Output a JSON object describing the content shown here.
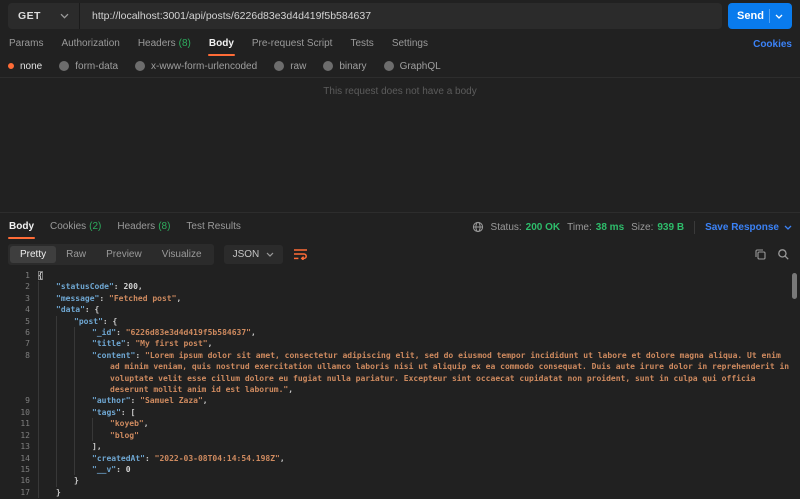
{
  "request": {
    "method": "GET",
    "url": "http://localhost:3001/api/posts/6226d83e3d4d419f5b584637",
    "send_label": "Send",
    "cookies_link": "Cookies",
    "tabs": [
      {
        "label": "Params"
      },
      {
        "label": "Authorization"
      },
      {
        "label": "Headers",
        "count": "(8)"
      },
      {
        "label": "Body",
        "active": true
      },
      {
        "label": "Pre-request Script"
      },
      {
        "label": "Tests"
      },
      {
        "label": "Settings"
      }
    ],
    "body_types": [
      {
        "label": "none",
        "selected": true
      },
      {
        "label": "form-data"
      },
      {
        "label": "x-www-form-urlencoded"
      },
      {
        "label": "raw"
      },
      {
        "label": "binary"
      },
      {
        "label": "GraphQL"
      }
    ],
    "empty_body_message": "This request does not have a body"
  },
  "response": {
    "tabs": [
      {
        "label": "Body",
        "active": true
      },
      {
        "label": "Cookies",
        "count": "(2)"
      },
      {
        "label": "Headers",
        "count": "(8)"
      },
      {
        "label": "Test Results"
      }
    ],
    "meta": {
      "status_label": "Status:",
      "status_value": "200 OK",
      "time_label": "Time:",
      "time_value": "38 ms",
      "size_label": "Size:",
      "size_value": "939 B",
      "save_label": "Save Response"
    },
    "view_tabs": [
      {
        "label": "Pretty",
        "active": true
      },
      {
        "label": "Raw"
      },
      {
        "label": "Preview"
      },
      {
        "label": "Visualize"
      }
    ],
    "format": "JSON"
  },
  "colors": {
    "accent_orange": "#ff6c37",
    "send_blue": "#097bed",
    "link_blue": "#3b82f6",
    "success_green": "#2ebd6b",
    "json_key": "#6fa7d2",
    "json_string": "#ce8a5f"
  },
  "code": {
    "lines": [
      {
        "n": 1,
        "indent": 0,
        "tokens": [
          {
            "t": "p",
            "v": "{",
            "hl": true
          }
        ]
      },
      {
        "n": 2,
        "indent": 1,
        "tokens": [
          {
            "t": "k",
            "v": "\"statusCode\""
          },
          {
            "t": "p",
            "v": ": "
          },
          {
            "t": "n",
            "v": "200"
          },
          {
            "t": "p",
            "v": ","
          }
        ]
      },
      {
        "n": 3,
        "indent": 1,
        "tokens": [
          {
            "t": "k",
            "v": "\"message\""
          },
          {
            "t": "p",
            "v": ": "
          },
          {
            "t": "s",
            "v": "\"Fetched post\""
          },
          {
            "t": "p",
            "v": ","
          }
        ]
      },
      {
        "n": 4,
        "indent": 1,
        "tokens": [
          {
            "t": "k",
            "v": "\"data\""
          },
          {
            "t": "p",
            "v": ": {"
          }
        ]
      },
      {
        "n": 5,
        "indent": 2,
        "tokens": [
          {
            "t": "k",
            "v": "\"post\""
          },
          {
            "t": "p",
            "v": ": {"
          }
        ]
      },
      {
        "n": 6,
        "indent": 3,
        "tokens": [
          {
            "t": "k",
            "v": "\"_id\""
          },
          {
            "t": "p",
            "v": ": "
          },
          {
            "t": "s",
            "v": "\"6226d83e3d4d419f5b584637\""
          },
          {
            "t": "p",
            "v": ","
          }
        ]
      },
      {
        "n": 7,
        "indent": 3,
        "tokens": [
          {
            "t": "k",
            "v": "\"title\""
          },
          {
            "t": "p",
            "v": ": "
          },
          {
            "t": "s",
            "v": "\"My first post\""
          },
          {
            "t": "p",
            "v": ","
          }
        ]
      },
      {
        "n": 8,
        "indent": 3,
        "tokens": [
          {
            "t": "k",
            "v": "\"content\""
          },
          {
            "t": "p",
            "v": ": "
          },
          {
            "t": "s",
            "v": "\"Lorem ipsum dolor sit amet, consectetur adipiscing elit, sed do eiusmod tempor incididunt ut labore et dolore magna aliqua. Ut enim ad minim veniam, quis nostrud exercitation ullamco laboris nisi ut aliquip ex ea commodo consequat. Duis aute irure dolor in reprehenderit in voluptate velit esse cillum dolore eu fugiat nulla pariatur. Excepteur sint occaecat cupidatat non proident, sunt in culpa qui officia deserunt mollit anim id est laborum.\""
          },
          {
            "t": "p",
            "v": ","
          }
        ]
      },
      {
        "n": 9,
        "indent": 3,
        "tokens": [
          {
            "t": "k",
            "v": "\"author\""
          },
          {
            "t": "p",
            "v": ": "
          },
          {
            "t": "s",
            "v": "\"Samuel Zaza\""
          },
          {
            "t": "p",
            "v": ","
          }
        ]
      },
      {
        "n": 10,
        "indent": 3,
        "tokens": [
          {
            "t": "k",
            "v": "\"tags\""
          },
          {
            "t": "p",
            "v": ": ["
          }
        ]
      },
      {
        "n": 11,
        "indent": 4,
        "tokens": [
          {
            "t": "s",
            "v": "\"koyeb\""
          },
          {
            "t": "p",
            "v": ","
          }
        ]
      },
      {
        "n": 12,
        "indent": 4,
        "tokens": [
          {
            "t": "s",
            "v": "\"blog\""
          }
        ]
      },
      {
        "n": 13,
        "indent": 3,
        "tokens": [
          {
            "t": "p",
            "v": "],"
          }
        ]
      },
      {
        "n": 14,
        "indent": 3,
        "tokens": [
          {
            "t": "k",
            "v": "\"createdAt\""
          },
          {
            "t": "p",
            "v": ": "
          },
          {
            "t": "s",
            "v": "\"2022-03-08T04:14:54.198Z\""
          },
          {
            "t": "p",
            "v": ","
          }
        ]
      },
      {
        "n": 15,
        "indent": 3,
        "tokens": [
          {
            "t": "k",
            "v": "\"__v\""
          },
          {
            "t": "p",
            "v": ": "
          },
          {
            "t": "n",
            "v": "0"
          }
        ]
      },
      {
        "n": 16,
        "indent": 2,
        "tokens": [
          {
            "t": "p",
            "v": "}"
          }
        ]
      },
      {
        "n": 17,
        "indent": 1,
        "tokens": [
          {
            "t": "p",
            "v": "}"
          }
        ]
      }
    ]
  }
}
